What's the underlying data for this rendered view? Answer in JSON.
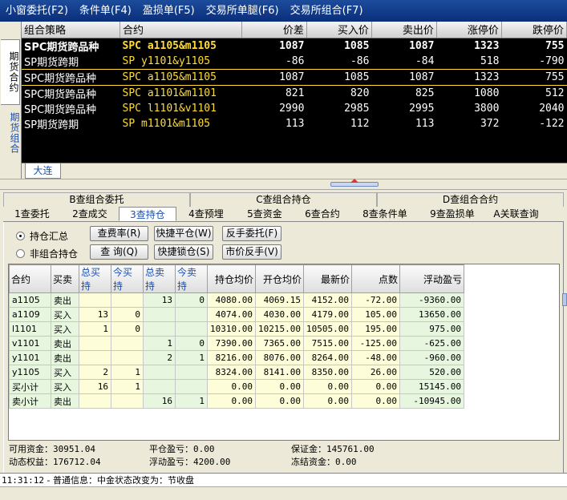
{
  "menu": [
    {
      "label": "小窗委托(F2)"
    },
    {
      "label": "条件单(F4)"
    },
    {
      "label": "盈损单(F5)"
    },
    {
      "label": "交易所单腿(F6)"
    },
    {
      "label": "交易所组合(F7)"
    }
  ],
  "side_tabs": [
    {
      "label": "期货合约"
    },
    {
      "label": "期货组合"
    }
  ],
  "quote": {
    "headers": [
      "组合策略",
      "合约",
      "价差",
      "买入价",
      "卖出价",
      "涨停价",
      "跌停价"
    ],
    "rows": [
      {
        "strategy": "SPC期货跨品种",
        "contract": "SPC a1105&m1105",
        "spread": "1087",
        "bid": "1085",
        "ask": "1087",
        "up_limit": "1323",
        "down_limit": "755"
      },
      {
        "strategy": "SP期货跨期",
        "contract": "SP y1101&y1105",
        "spread": "-86",
        "bid": "-86",
        "ask": "-84",
        "up_limit": "518",
        "down_limit": "-790"
      },
      {
        "strategy": "SPC期货跨品种",
        "contract": "SPC a1105&m1105",
        "spread": "1087",
        "bid": "1085",
        "ask": "1087",
        "up_limit": "1323",
        "down_limit": "755"
      },
      {
        "strategy": "SPC期货跨品种",
        "contract": "SPC a1101&m1101",
        "spread": "821",
        "bid": "820",
        "ask": "825",
        "up_limit": "1080",
        "down_limit": "512"
      },
      {
        "strategy": "SPC期货跨品种",
        "contract": "SPC l1101&v1101",
        "spread": "2990",
        "bid": "2985",
        "ask": "2995",
        "up_limit": "3800",
        "down_limit": "2040"
      },
      {
        "strategy": "SP期货跨期",
        "contract": "SP m1101&m1105",
        "spread": "113",
        "bid": "112",
        "ask": "113",
        "up_limit": "372",
        "down_limit": "-122"
      }
    ],
    "exchange_tab": "大连"
  },
  "query_tabs_top": [
    {
      "label": "B查组合委托"
    },
    {
      "label": "C查组合持仓"
    },
    {
      "label": "D查组合合约"
    }
  ],
  "query_tabs": [
    {
      "label": "1查委托"
    },
    {
      "label": "2查成交"
    },
    {
      "label": "3查持仓"
    },
    {
      "label": "4查预埋"
    },
    {
      "label": "5查资金"
    },
    {
      "label": "6查合约"
    },
    {
      "label": "8查条件单"
    },
    {
      "label": "9查盈损单"
    },
    {
      "label": "A关联查询"
    }
  ],
  "radios": {
    "summary": "持仓汇总",
    "detail": "非组合持仓"
  },
  "buttons": {
    "fee": "查费率(R)",
    "fastclose": "快捷平仓(W)",
    "reverse": "反手委托(F)",
    "margin": "查 询(Q)",
    "fastlock": "快捷锁仓(S)",
    "mktreverse": "市价反手(V)"
  },
  "positions": {
    "headers": [
      "合约",
      "买卖",
      "总买持",
      "今买持",
      "总卖持",
      "今卖持",
      "持仓均价",
      "开仓均价",
      "最新价",
      "点数",
      "浮动盈亏"
    ],
    "rows": [
      [
        "a1105",
        "卖出",
        "",
        "",
        "13",
        "0",
        "4080.00",
        "4069.15",
        "4152.00",
        "-72.00",
        "-9360.00"
      ],
      [
        "a1109",
        "买入",
        "13",
        "0",
        "",
        "",
        "4074.00",
        "4030.00",
        "4179.00",
        "105.00",
        "13650.00"
      ],
      [
        "l1101",
        "买入",
        "1",
        "0",
        "",
        "",
        "10310.00",
        "10215.00",
        "10505.00",
        "195.00",
        "975.00"
      ],
      [
        "v1101",
        "卖出",
        "",
        "",
        "1",
        "0",
        "7390.00",
        "7365.00",
        "7515.00",
        "-125.00",
        "-625.00"
      ],
      [
        "y1101",
        "卖出",
        "",
        "",
        "2",
        "1",
        "8216.00",
        "8076.00",
        "8264.00",
        "-48.00",
        "-960.00"
      ],
      [
        "y1105",
        "买入",
        "2",
        "1",
        "",
        "",
        "8324.00",
        "8141.00",
        "8350.00",
        "26.00",
        "520.00"
      ],
      [
        "买小计",
        "买入",
        "16",
        "1",
        "",
        "",
        "0.00",
        "0.00",
        "0.00",
        "0.00",
        "15145.00"
      ],
      [
        "卖小计",
        "卖出",
        "",
        "",
        "16",
        "1",
        "0.00",
        "0.00",
        "0.00",
        "0.00",
        "-10945.00"
      ]
    ]
  },
  "summary": {
    "available": "可用资金：30951.04",
    "equity": "动态权益：176712.04",
    "close_pnl": "平仓盈亏：0.00",
    "float_pnl": "浮动盈亏：4200.00",
    "margin": "保证金：145761.00",
    "frozen": "冻结资金：0.00"
  },
  "status": {
    "time": "11:31:12",
    "message": " - 普通信息：中金状态改变为：节收盘"
  }
}
